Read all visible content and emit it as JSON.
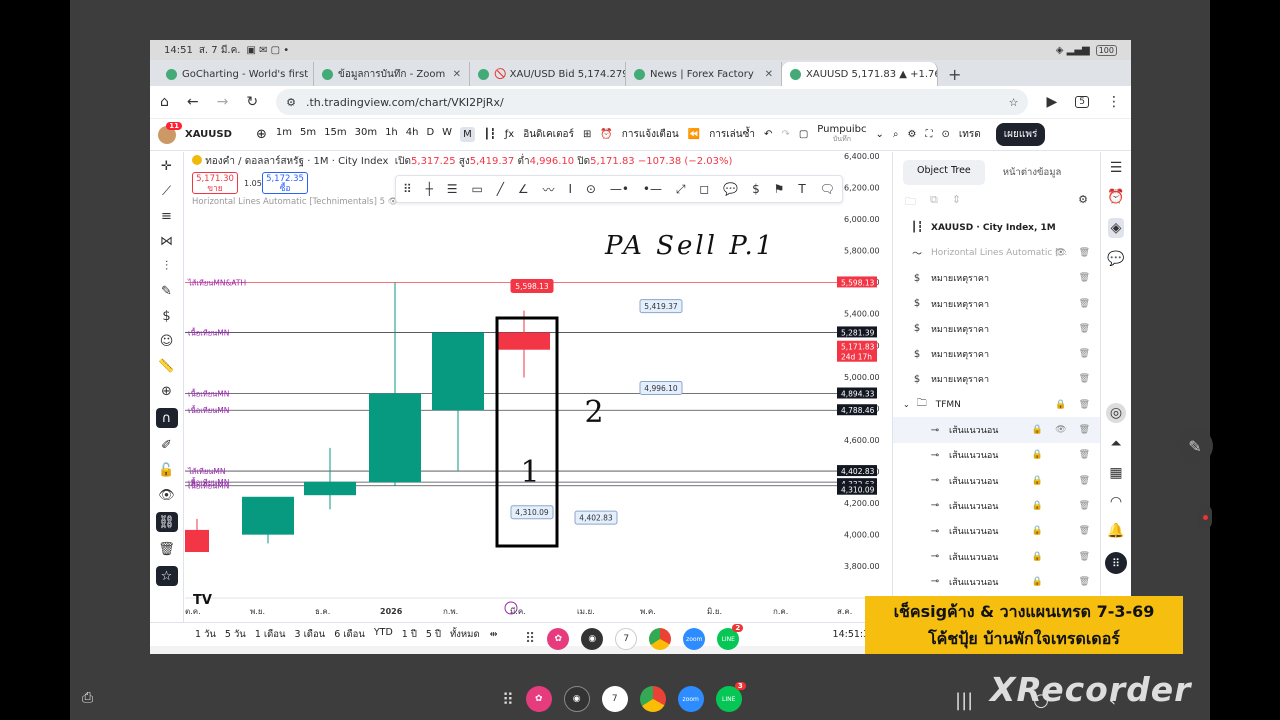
{
  "os": {
    "time": "14:51",
    "date": "ส. 7 มี.ค.",
    "battery": "100"
  },
  "tabs": [
    {
      "label": "GoCharting - World's first",
      "active": false
    },
    {
      "label": "ข้อมูลการบันทึก - Zoom",
      "active": false
    },
    {
      "label": "🚫 XAU/USD Bid 5,174.279",
      "active": false
    },
    {
      "label": "News | Forex Factory",
      "active": false
    },
    {
      "label": "XAUUSD 5,171.83 ▲ +1.76%",
      "active": true
    }
  ],
  "url": ".th.tradingview.com/chart/VKI2PjRx/",
  "tabcount": "5",
  "toolbar": {
    "notif": "11",
    "symbol": "XAUUSD",
    "intervals": [
      "1m",
      "5m",
      "15m",
      "30m",
      "1h",
      "4h",
      "D",
      "W",
      "M"
    ],
    "active_interval": "M",
    "indicators": "อินดิเคเตอร์",
    "alerts": "การแจ้งเตือน",
    "replay": "การเล่นซ้ำ",
    "layout_name": "Pumpuibc",
    "layout_sub": "บันทึก",
    "trade": "เทรด",
    "publish": "เผยแพร่"
  },
  "legend": {
    "title": "ทองคำ / ดอลลาร์สหรัฐ · 1M · City Index",
    "o_label": "เปิด",
    "o": "5,317.25",
    "h_label": "สูง",
    "h": "5,419.37",
    "l_label": "ต่ำ",
    "l": "4,996.10",
    "c_label": "ปิด",
    "c": "5,171.83",
    "chg": "−107.38 (−2.03%)",
    "sell_price": "5,171.30",
    "sell_label": "ขาย",
    "spread": "1.05",
    "buy_price": "5,172.35",
    "buy_label": "ซื้อ",
    "indicator": "Horizontal Lines Automatic [Technimentals] 5"
  },
  "handwriting": "PA Sell P.1",
  "candle_labels": {
    "c1": "1",
    "c2": "2"
  },
  "price_tags": {
    "high1": "5,598.13",
    "high3": "5,419.37",
    "low1": "4,310.09",
    "low2": "4,402.83",
    "low3": "4,996.10"
  },
  "line_labels": [
    "ไส้เทียนMN&ATH",
    "เนื้อเทียนMN",
    "เนื้อเทียนMN",
    "เนื้อเทียนMN",
    "ไส้เทียนMN",
    "เนื้อเทียนMN",
    "เนื้อเทียนMN"
  ],
  "price_axis": [
    "6,400.00",
    "6,200.00",
    "6,000.00",
    "5,800.00",
    "5,600.00",
    "5,400.00",
    "5,200.00",
    "5,000.00",
    "4,800.00",
    "4,600.00",
    "4,400.00",
    "4,200.00",
    "4,000.00",
    "3,800.00"
  ],
  "axis_tags": [
    {
      "text": "5,598.13",
      "color": "#f23645"
    },
    {
      "text": "5,281.39",
      "color": "#131722"
    },
    {
      "text": "5,171.83",
      "color": "#f23645"
    },
    {
      "text": "24d 17h",
      "color": "#f23645"
    },
    {
      "text": "4,894.33",
      "color": "#131722"
    },
    {
      "text": "4,788.46",
      "color": "#131722"
    },
    {
      "text": "4,402.83",
      "color": "#131722"
    },
    {
      "text": "4,332.63",
      "color": "#131722"
    },
    {
      "text": "4,310.09",
      "color": "#131722"
    }
  ],
  "time_axis": [
    "ต.ค.",
    "พ.ย.",
    "ธ.ค.",
    "2026",
    "ก.พ.",
    "มี.ค.",
    "เม.ย.",
    "พ.ค.",
    "มิ.ย.",
    "ก.ค.",
    "ส.ค."
  ],
  "chart_data": {
    "type": "candlestick",
    "categories": [
      "ต.ค.",
      "พ.ย.",
      "ธ.ค.",
      "2026",
      "ก.พ.",
      "มี.ค."
    ],
    "series": [
      {
        "open": 4030,
        "high": 4100,
        "low": 3900,
        "close": 3890
      },
      {
        "open": 4000,
        "high": 4220,
        "low": 3945,
        "close": 4240
      },
      {
        "open": 4250,
        "high": 4550,
        "low": 4160,
        "close": 4335
      },
      {
        "open": 4332.63,
        "high": 5598.13,
        "low": 4310.09,
        "close": 4894.33
      },
      {
        "open": 4788.46,
        "high": 5281.39,
        "low": 4402.83,
        "close": 5281.39
      },
      {
        "open": 5281.39,
        "high": 5419.37,
        "low": 4996.1,
        "close": 5171.83
      }
    ],
    "ylim": [
      3700,
      6450
    ]
  },
  "bottom": {
    "ranges": [
      "1 วัน",
      "5 วัน",
      "1 เดือน",
      "3 เดือน",
      "6 เดือน",
      "YTD",
      "1 ปี",
      "5 ปี",
      "ทั้งหมด"
    ],
    "time": "14:51:32 UT"
  },
  "panel": {
    "tab1": "Object Tree",
    "tab2": "หน้าต่างข้อมูล",
    "items": [
      {
        "icon": "candles-icon",
        "label": "XAUUSD · City Index, 1M",
        "bold": true
      },
      {
        "icon": "wave-icon",
        "label": "Horizontal Lines Automatic [...",
        "muted": true
      },
      {
        "icon": "note-icon",
        "label": "หมายเหตุราคา"
      },
      {
        "icon": "note-icon",
        "label": "หมายเหตุราคา"
      },
      {
        "icon": "note-icon",
        "label": "หมายเหตุราคา"
      },
      {
        "icon": "note-icon",
        "label": "หมายเหตุราคา"
      },
      {
        "icon": "note-icon",
        "label": "หมายเหตุราคา"
      },
      {
        "icon": "folder-icon",
        "label": "TFMN",
        "folder": true
      },
      {
        "icon": "hline-icon",
        "label": "เส้นแนวนอน",
        "selected": true
      },
      {
        "icon": "hline-icon",
        "label": "เส้นแนวนอน"
      },
      {
        "icon": "hline-icon",
        "label": "เส้นแนวนอน"
      },
      {
        "icon": "hline-icon",
        "label": "เส้นแนวนอน"
      },
      {
        "icon": "hline-icon",
        "label": "เส้นแนวนอน"
      },
      {
        "icon": "hline-icon",
        "label": "เส้นแนวนอน"
      },
      {
        "icon": "hline-icon",
        "label": "เส้นแนวนอน"
      }
    ]
  },
  "dock_badges": {
    "calendar": "7",
    "line": "2",
    "line_big": "3"
  },
  "banner": {
    "line1": "เช็คsigค้าง & วางแผนเทรด 7-3-69",
    "line2": "โค้ชปุ้ย บ้านพักใจเทรดเดอร์"
  },
  "watermark": "XRecorder"
}
